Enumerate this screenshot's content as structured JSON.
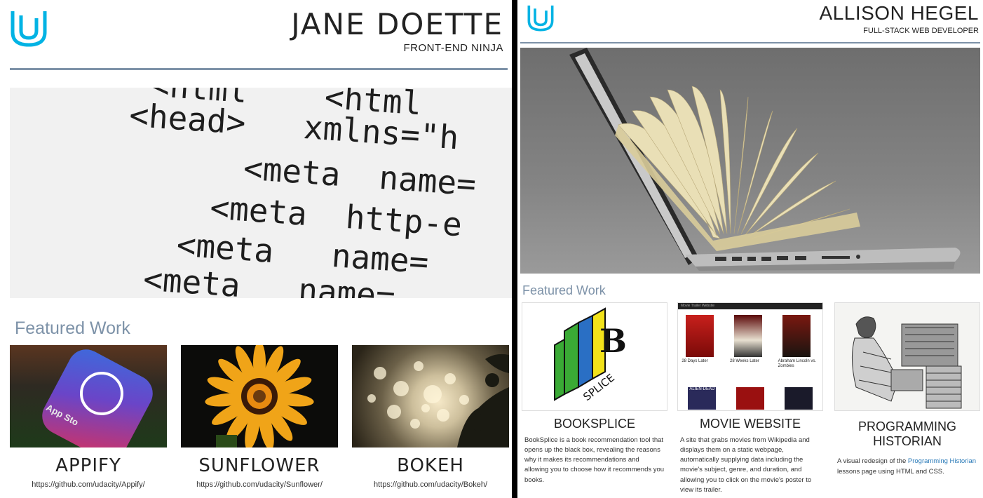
{
  "left": {
    "name": "JANE DOETTE",
    "role": "FRONT-END NINJA",
    "hero_code_lines": [
      "<html    <html",
      "<head>   xmlns=\"h",
      "   <meta  name=",
      "  <meta  http-e",
      " <meta   name=",
      "<meta   name="
    ],
    "featured_heading": "Featured Work",
    "projects": [
      {
        "title": "APPIFY",
        "url": "https://github.com/udacity/Appify/",
        "thumb_text": "App Sto"
      },
      {
        "title": "SUNFLOWER",
        "url": "https://github.com/udacity/Sunflower/"
      },
      {
        "title": "BOKEH",
        "url": "https://github.com/udacity/Bokeh/"
      }
    ]
  },
  "right": {
    "name": "ALLISON HEGEL",
    "role": "FULL-STACK WEB DEVELOPER",
    "featured_heading": "Featured Work",
    "projects": [
      {
        "title": "BOOKSPLICE",
        "description": "BookSplice is a book recommendation tool that opens up the black box, revealing the reasons why it makes its recommendations and allowing you to choose how it recommends you books.",
        "logo_letter": "B",
        "logo_text": "SPLICE"
      },
      {
        "title": "MOVIE WEBSITE",
        "description": "A site that grabs movies from Wikipedia and displays them on a static webpage, automatically supplying data including the movie's subject, genre, and duration, and allowing you to click on the movie's poster to view its trailer.",
        "thumb_header": "Movie Trailer Website",
        "movies": [
          "28 Days Later",
          "28 Weeks Later",
          "Abraham Lincoln vs. Zombies"
        ],
        "movies_row2": [
          "ALIEN-DEAD",
          "",
          ""
        ]
      },
      {
        "title_line1": "PROGRAMMING",
        "title_line2": "HISTORIAN",
        "desc_before": "A visual redesign of the ",
        "desc_link": "Programming Historian",
        "desc_after": " lessons page using HTML and CSS."
      }
    ]
  },
  "colors": {
    "udacity_blue": "#02b3e4",
    "accent_slate": "#7d92a8",
    "link_blue": "#2a7ab8"
  }
}
